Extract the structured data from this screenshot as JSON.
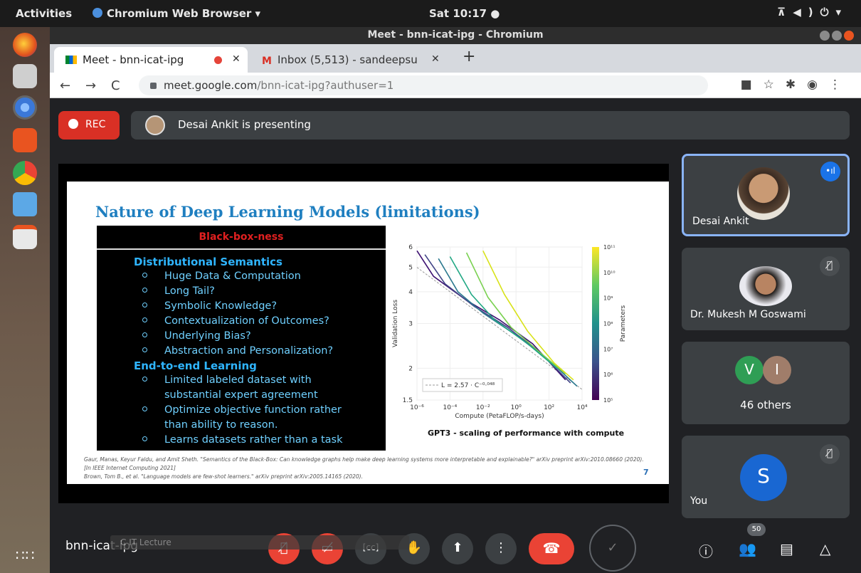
{
  "system": {
    "activities": "Activities",
    "app_name": "Chromium Web Browser ▾",
    "clock": "Sat 10:17 ●"
  },
  "window": {
    "title": "Meet - bnn-icat-ipg - Chromium"
  },
  "tabs": [
    {
      "label": "Meet - bnn-icat-ipg"
    },
    {
      "label": "Inbox (5,513) - sandeepsu"
    }
  ],
  "address": {
    "host": "meet.google.com",
    "path": "/bnn-icat-ipg?authuser=1"
  },
  "meet": {
    "rec_label": "REC",
    "presenting_text": "Desai Ankit is presenting",
    "meeting_name": "bnn-icat-ipg",
    "participant_count_badge": "50"
  },
  "slide": {
    "title": "Nature of Deep Learning Models (limitations)",
    "box_heading": "Black-box-ness",
    "section1": "Distributional Semantics",
    "bullets1": [
      "Huge Data & Computation",
      "Long Tail?",
      "Symbolic Knowledge?",
      "Contextualization of Outcomes?",
      "Underlying Bias?",
      "Abstraction and Personalization?"
    ],
    "section2": "End-to-end Learning",
    "bullets2a_1": "Limited labeled dataset with",
    "bullets2a_2": "substantial expert agreement",
    "bullets2b_1": "Optimize objective function rather",
    "bullets2b_2": "than ability to reason.",
    "bullets2c": "Learns datasets rather than a task",
    "caption": "GPT3 - scaling of performance with compute",
    "ref1": "Gaur, Manas, Keyur Faldu, and Amit Sheth. \"Semantics of the Black-Box: Can knowledge graphs help make deep learning systems more interpretable and explainable?\" arXiv preprint arXiv:2010.08660 (2020).[In IEEE Internet Computing 2021]",
    "ref2": "Brown, Tom B., et al. \"Language models are few-shot learners.\" arXiv preprint arXiv:2005.14165 (2020).",
    "page_number": "7"
  },
  "chart_data": {
    "type": "line",
    "xlabel": "Compute (PetaFLOP/s-days)",
    "ylabel": "Validation Loss",
    "x_ticks": [
      "10⁻⁶",
      "10⁻⁴",
      "10⁻²",
      "10⁰",
      "10²",
      "10⁴"
    ],
    "y_ticks": [
      "1.5",
      "2",
      "3",
      "4",
      "5",
      "6"
    ],
    "xscale": "log",
    "yscale": "log",
    "xlim": [
      1e-06,
      10000.0
    ],
    "ylim": [
      1.5,
      6
    ],
    "colorbar_label": "Parameters",
    "colorbar_ticks": [
      "10⁵",
      "10⁶",
      "10⁷",
      "10⁸",
      "10⁹",
      "10¹⁰",
      "10¹¹"
    ],
    "legend": "L = 2.57 · C⁻⁰·⁰⁴⁸",
    "power_law": {
      "a": 2.57,
      "exponent": -0.048
    },
    "series": [
      {
        "values": [
          [
            5e-07,
            5.8
          ],
          [
            1e-05,
            4.6
          ],
          [
            0.001,
            3.7
          ],
          [
            0.1,
            3.1
          ],
          [
            10,
            2.5
          ],
          [
            1000,
            1.8
          ]
        ],
        "color": "#3b0f70"
      },
      {
        "values": [
          [
            3e-06,
            5.6
          ],
          [
            5e-05,
            4.3
          ],
          [
            0.003,
            3.5
          ],
          [
            0.3,
            2.9
          ],
          [
            30,
            2.3
          ],
          [
            2000,
            1.75
          ]
        ],
        "color": "#414487"
      },
      {
        "values": [
          [
            2e-05,
            5.4
          ],
          [
            0.0003,
            4.0
          ],
          [
            0.01,
            3.3
          ],
          [
            1,
            2.7
          ],
          [
            100,
            2.15
          ],
          [
            5000,
            1.7
          ]
        ],
        "color": "#2a788e"
      },
      {
        "values": [
          [
            0.0001,
            5.5
          ],
          [
            0.002,
            3.9
          ],
          [
            0.05,
            3.1
          ],
          [
            5,
            2.5
          ],
          [
            300,
            2.0
          ]
        ],
        "color": "#22a884"
      },
      {
        "values": [
          [
            0.001,
            5.7
          ],
          [
            0.02,
            3.8
          ],
          [
            0.5,
            2.9
          ],
          [
            30,
            2.3
          ],
          [
            1000,
            1.9
          ]
        ],
        "color": "#7ad151"
      },
      {
        "values": [
          [
            0.01,
            5.8
          ],
          [
            0.2,
            3.9
          ],
          [
            5,
            2.8
          ],
          [
            200,
            2.1
          ],
          [
            3000,
            1.8
          ]
        ],
        "color": "#d8e219"
      }
    ]
  },
  "participants": [
    {
      "name": "Desai Ankit"
    },
    {
      "name": "Dr. Mukesh M Goswami"
    },
    {
      "name": "46 others",
      "initials": [
        "V",
        "I"
      ]
    },
    {
      "name": "You",
      "initial": "S"
    }
  ],
  "ghost_bar": "C IT Lecture"
}
